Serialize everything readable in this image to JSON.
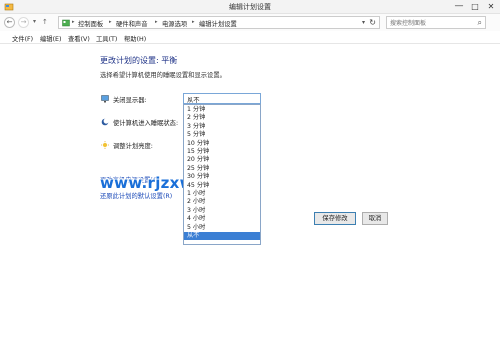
{
  "window": {
    "title": "编辑计划设置",
    "minimize": "—",
    "maximize": "□",
    "close": "✕"
  },
  "addressbar": {
    "breadcrumbs": [
      "控制面板",
      "硬件和声音",
      "电源选项",
      "编辑计划设置"
    ],
    "search_placeholder": "搜索控制面板"
  },
  "menu": [
    "文件(F)",
    "编辑(E)",
    "查看(V)",
    "工具(T)",
    "帮助(H)"
  ],
  "plan": {
    "heading": "更改计划的设置: 平衡",
    "description": "选择希望计算机使用的睡眠设置和显示设置。",
    "turn_off_display_label": "关闭显示器:",
    "turn_off_display_value": "从不",
    "sleep_label": "使计算机进入睡眠状态:",
    "brightness_label": "调整计划亮度:"
  },
  "dropdown_options": [
    "1 分钟",
    "2 分钟",
    "3 分钟",
    "5 分钟",
    "10 分钟",
    "15 分钟",
    "20 分钟",
    "25 分钟",
    "30 分钟",
    "45 分钟",
    "1 小时",
    "2 小时",
    "3 小时",
    "4 小时",
    "5 小时",
    "从不"
  ],
  "dropdown_selected_index": 15,
  "links": {
    "advanced": "更改高级电源设置(C)",
    "restore": "还原此计划的默认设置(R)"
  },
  "watermark": "www.rjzxw.com",
  "buttons": {
    "save": "保存修改",
    "cancel": "取消"
  },
  "colors": {
    "heading": "#1e3287",
    "link": "#1a49b8",
    "selection": "#3b7fd4"
  }
}
